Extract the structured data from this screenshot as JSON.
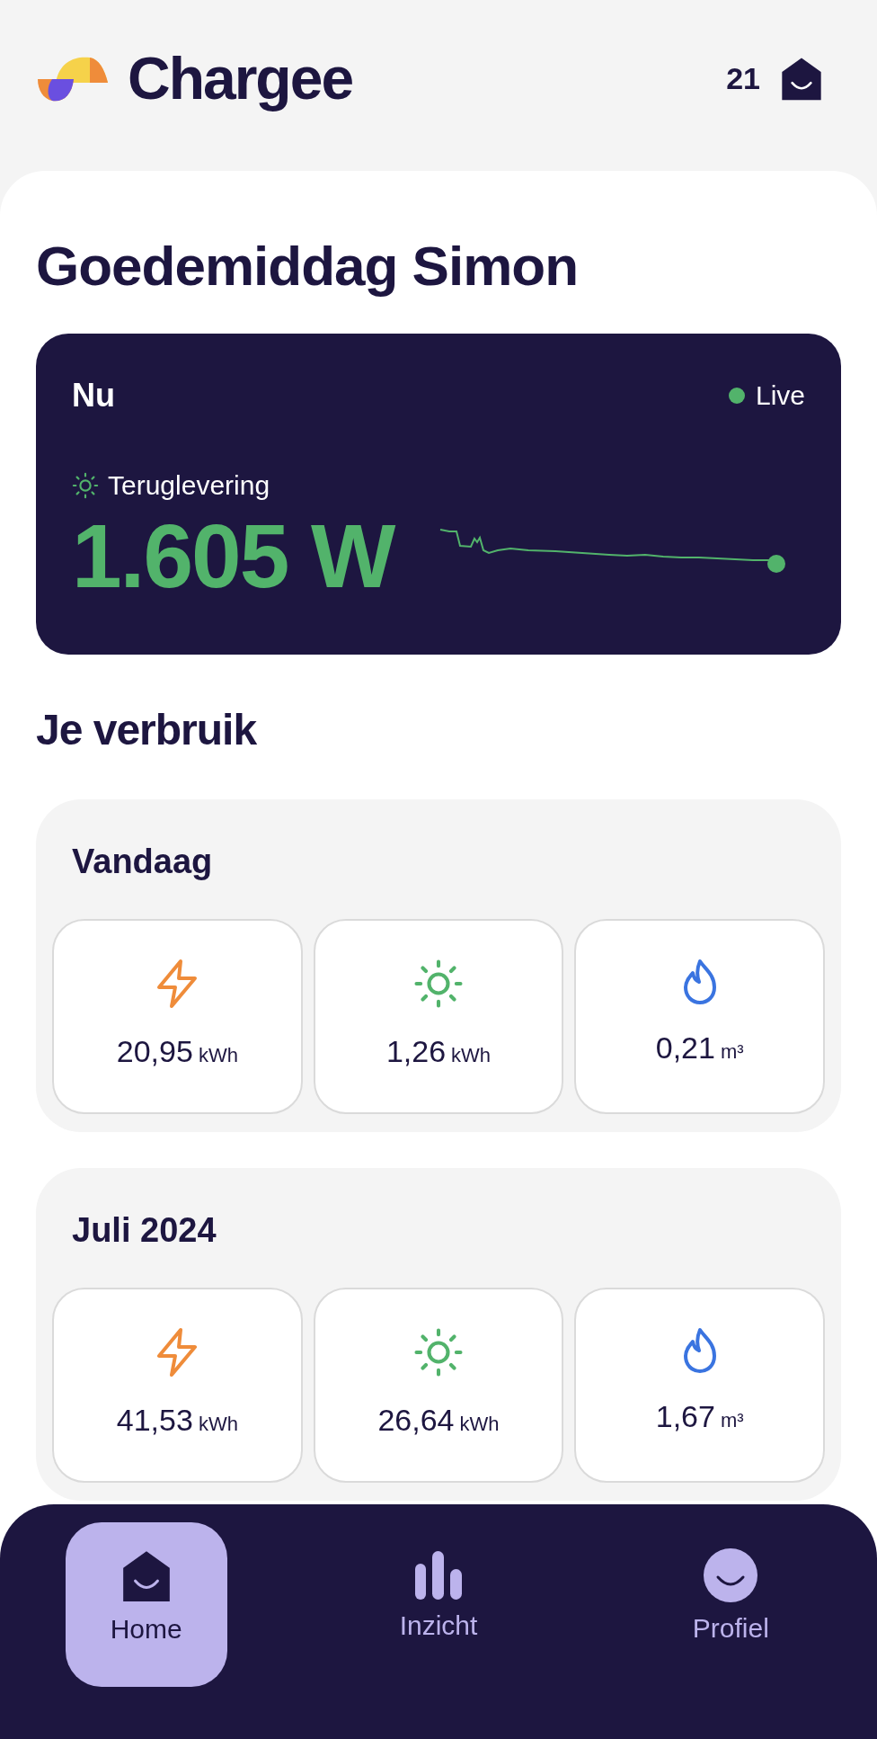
{
  "header": {
    "brand": "Chargee",
    "home_count": "21"
  },
  "greeting": "Goedemiddag Simon",
  "now_card": {
    "title": "Nu",
    "live": true,
    "live_label": "Live",
    "mode_label": "Teruglevering",
    "value": "1.605 W"
  },
  "usage_title": "Je verbruik",
  "periods": [
    {
      "title": "Vandaag",
      "stats": [
        {
          "kind": "electricity",
          "value": "20,95",
          "unit": "kWh"
        },
        {
          "kind": "solar",
          "value": "1,26",
          "unit": "kWh"
        },
        {
          "kind": "gas",
          "value": "0,21",
          "unit": "m³"
        }
      ]
    },
    {
      "title": "Juli 2024",
      "stats": [
        {
          "kind": "electricity",
          "value": "41,53",
          "unit": "kWh"
        },
        {
          "kind": "solar",
          "value": "26,64",
          "unit": "kWh"
        },
        {
          "kind": "gas",
          "value": "1,67",
          "unit": "m³"
        }
      ]
    }
  ],
  "nav": [
    {
      "label": "Home",
      "kind": "home",
      "selected": true
    },
    {
      "label": "Inzicht",
      "kind": "insight",
      "selected": false
    },
    {
      "label": "Profiel",
      "kind": "profile",
      "selected": false
    }
  ]
}
